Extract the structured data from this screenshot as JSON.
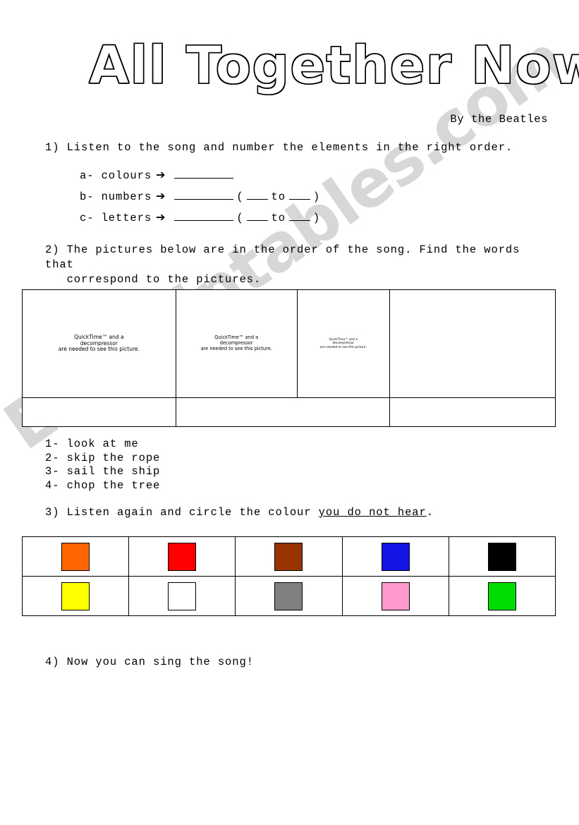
{
  "title": "All Together Now",
  "byline": "By the Beatles",
  "exercise1": {
    "prompt": "1) Listen to the song and number the elements in the right order.",
    "items": [
      {
        "label": "a- colours",
        "arrow": "➔",
        "has_range": false,
        "open_paren": "(",
        "to": "to",
        "close_paren": ")"
      },
      {
        "label": "b- numbers",
        "arrow": "➔",
        "has_range": true,
        "open_paren": "(",
        "to": "to",
        "close_paren": ")"
      },
      {
        "label": "c- letters",
        "arrow": "➔",
        "has_range": true,
        "open_paren": "(",
        "to": "to",
        "close_paren": ")"
      }
    ]
  },
  "exercise2": {
    "prompt": "2) The pictures below are in the order of the song. Find the words that\n   correspond to the pictures.",
    "placeholder_text": "QuickTime™ and a\ndecompressor\nare needed to see this picture.",
    "picture_cells": [
      {
        "placeholder": "QuickTime™ and a\ndecompressor\nare needed to see this picture.",
        "size": "large"
      },
      {
        "placeholder": "QuickTime™ and a\ndecompressor\nare needed to see this picture.",
        "size": "medium"
      },
      {
        "placeholder": "QuickTime™ and a\ndecompressor\nare needed to see this picture.",
        "size": "small"
      },
      {
        "placeholder": "",
        "size": "empty"
      }
    ],
    "answer_cells": [
      "",
      "",
      ""
    ],
    "word_options": [
      "1- look at me",
      "2- skip the rope",
      "3- sail the ship",
      "4- chop the tree"
    ]
  },
  "exercise3": {
    "prompt_before": "3) Listen again and circle the colour ",
    "prompt_underlined": "you do not hear",
    "prompt_after": ".",
    "colours": [
      {
        "name": "orange",
        "hex": "#FF6600"
      },
      {
        "name": "red",
        "hex": "#FF0000"
      },
      {
        "name": "brown",
        "hex": "#993300"
      },
      {
        "name": "blue",
        "hex": "#1414E6"
      },
      {
        "name": "black",
        "hex": "#000000"
      },
      {
        "name": "yellow",
        "hex": "#FFFF00"
      },
      {
        "name": "white",
        "hex": "#FFFFFF"
      },
      {
        "name": "grey",
        "hex": "#808080"
      },
      {
        "name": "pink",
        "hex": "#FF99CC"
      },
      {
        "name": "green",
        "hex": "#00DD00"
      }
    ]
  },
  "exercise4": {
    "prompt": "4) Now you can sing the song!"
  },
  "watermark": {
    "text": "ESLprintables.com",
    "color": "#CCCCCC"
  }
}
